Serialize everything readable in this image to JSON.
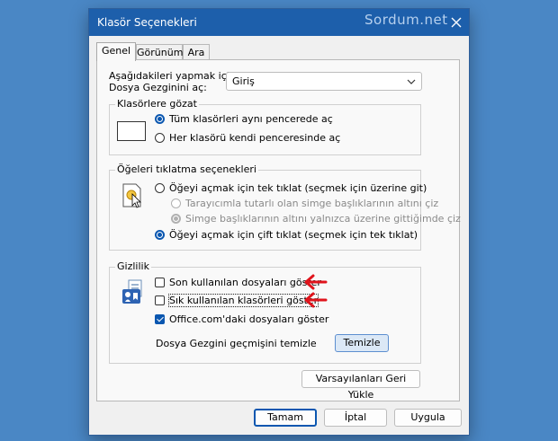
{
  "window": {
    "title": "Klasör Seçenekleri",
    "watermark": "Sordum.net"
  },
  "tabs": [
    {
      "label": "Genel",
      "active": true
    },
    {
      "label": "Görünüm",
      "active": false
    },
    {
      "label": "Ara",
      "active": false
    }
  ],
  "open_in": {
    "label_line1": "Aşağıdakileri yapmak için",
    "label_line2": "Dosya Gezginini aç:",
    "selected": "Giriş"
  },
  "browse_folders": {
    "legend": "Klasörlere gözat",
    "options": [
      {
        "label": "Tüm klasörleri aynı pencerede aç",
        "checked": true
      },
      {
        "label": "Her klasörü kendi penceresinde aç",
        "checked": false
      }
    ]
  },
  "click_items": {
    "legend": "Öğeleri tıklatma seçenekleri",
    "single_click": "Öğeyi açmak için tek tıklat (seçmek için üzerine git)",
    "underline_browser": "Tarayıcımla tutarlı olan simge başlıklarının altını çiz",
    "underline_hover": "Simge başlıklarının altını yalnızca üzerine gittiğimde çiz",
    "double_click": "Öğeyi açmak için çift tıklat (seçmek için tek tıklat)"
  },
  "privacy": {
    "legend": "Gizlilik",
    "recent_files": {
      "label": "Son kullanılan dosyaları göster",
      "checked": false
    },
    "frequent_folders": {
      "label": "Sık kullanılan klasörleri göster",
      "checked": false
    },
    "office_files": {
      "label": "Office.com'daki dosyaları göster",
      "checked": true
    },
    "clear_history_label": "Dosya Gezgini geçmişini temizle",
    "clear_button": "Temizle"
  },
  "restore_defaults": "Varsayılanları Geri Yükle",
  "footer": {
    "ok": "Tamam",
    "cancel": "İptal",
    "apply": "Uygula"
  },
  "colors": {
    "accent": "#0b57b0",
    "titlebar": "#1d5fab",
    "annotation_arrow": "#e0141c"
  }
}
